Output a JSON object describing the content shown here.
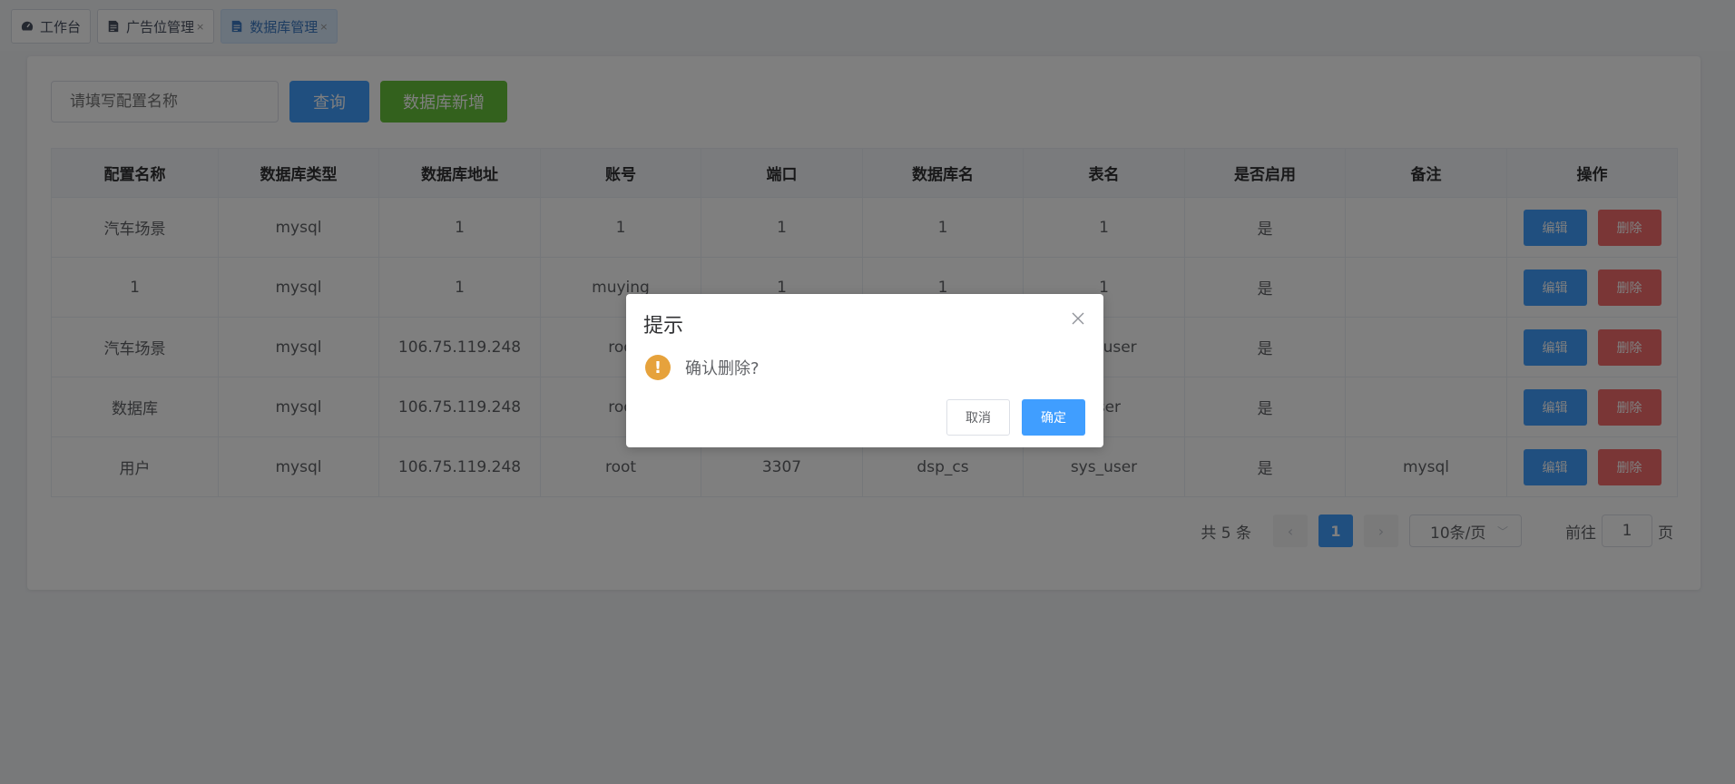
{
  "tabs": [
    {
      "label": "工作台",
      "icon": "dashboard-icon",
      "closable": false,
      "active": false
    },
    {
      "label": "广告位管理",
      "icon": "document-icon",
      "closable": true,
      "active": false
    },
    {
      "label": "数据库管理",
      "icon": "document-icon",
      "closable": true,
      "active": true
    }
  ],
  "toolbar": {
    "search_placeholder": "请填写配置名称",
    "query_label": "查询",
    "add_label": "数据库新增"
  },
  "table": {
    "headers": [
      "配置名称",
      "数据库类型",
      "数据库地址",
      "账号",
      "端口",
      "数据库名",
      "表名",
      "是否启用",
      "备注",
      "操作"
    ],
    "rows": [
      {
        "name": "汽车场景",
        "db_type": "mysql",
        "address": "1",
        "account": "1",
        "port": "1",
        "db_name": "1",
        "table_name": "1",
        "enabled": "是",
        "remark": ""
      },
      {
        "name": "1",
        "db_type": "mysql",
        "address": "1",
        "account": "muying",
        "port": "1",
        "db_name": "1",
        "table_name": "1",
        "enabled": "是",
        "remark": ""
      },
      {
        "name": "汽车场景",
        "db_type": "mysql",
        "address": "106.75.119.248",
        "account": "roo",
        "port": "",
        "db_name": "",
        "table_name": "car_user",
        "enabled": "是",
        "remark": ""
      },
      {
        "name": "数据库",
        "db_type": "mysql",
        "address": "106.75.119.248",
        "account": "roo",
        "port": "",
        "db_name": "",
        "table_name": "user",
        "enabled": "是",
        "remark": ""
      },
      {
        "name": "用户",
        "db_type": "mysql",
        "address": "106.75.119.248",
        "account": "root",
        "port": "3307",
        "db_name": "dsp_cs",
        "table_name": "sys_user",
        "enabled": "是",
        "remark": "mysql"
      }
    ],
    "edit_label": "编辑",
    "delete_label": "删除"
  },
  "pagination": {
    "total_text": "共 5 条",
    "current_page": "1",
    "page_size": "10条/页",
    "goto_label": "前往",
    "goto_value": "1",
    "page_suffix": "页"
  },
  "dialog": {
    "title": "提示",
    "message": "确认删除?",
    "warning_symbol": "!",
    "cancel_label": "取消",
    "confirm_label": "确定"
  }
}
